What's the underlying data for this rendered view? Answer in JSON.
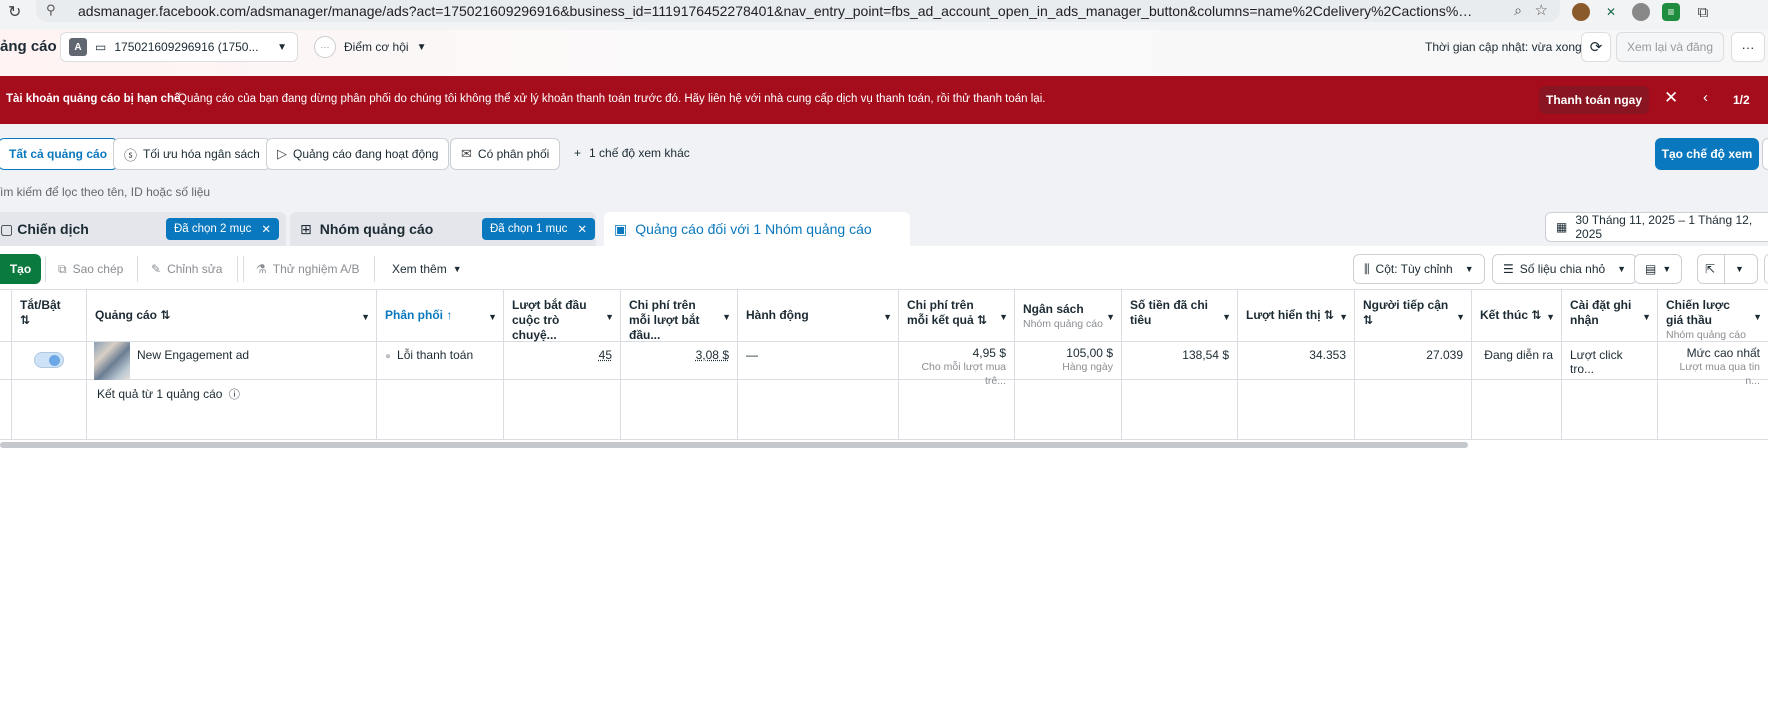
{
  "browser": {
    "url": "adsmanager.facebook.com/adsmanager/manage/ads?act=175021609296916&business_id=1119176452278401&nav_entry_point=fbs_ad_account_open_in_ads_manager_button&columns=name%2Cdelivery%2Cactions%3Aon..."
  },
  "header": {
    "title": "ảng cáo",
    "account_badge": "A",
    "account_label": "175021609296916 (1750...",
    "opportunity_label": "Điểm cơ hội",
    "updated_text": "Thời gian cập nhật: vừa xong",
    "review_label": "Xem lại và đăng",
    "more_label": "···"
  },
  "banner": {
    "title": "Tài khoản quảng cáo bị hạn chế",
    "text": "Quảng cáo của bạn đang dừng phân phối do chúng tôi không thể xử lý khoản thanh toán trước đó. Hãy liên hệ với nhà cung cấp dịch vụ thanh toán, rồi thử thanh toán lại.",
    "button": "Thanh toán ngay",
    "page": "1/2"
  },
  "views": {
    "tabs": [
      {
        "label": "Tất cả quảng cáo"
      },
      {
        "label": "Tối ưu hóa ngân sách"
      },
      {
        "label": "Quảng cáo đang hoạt động"
      },
      {
        "label": "Có phân phối"
      }
    ],
    "more": "1 chế độ xem khác",
    "create": "Tạo chế độ xem"
  },
  "search": {
    "placeholder": "ìm kiếm để lọc theo tên, ID hoặc số liệu"
  },
  "levels": {
    "campaign": "Chiến dịch",
    "campaign_chip": "Đã chọn 2 mục",
    "adset": "Nhóm quảng cáo",
    "adset_chip": "Đã chọn 1 mục",
    "ads": "Quảng cáo đối với 1 Nhóm quảng cáo",
    "date_range": "30 Tháng 11, 2025 – 1 Tháng 12, 2025"
  },
  "toolbar": {
    "create": "Tạo",
    "copy": "Sao chép",
    "edit": "Chỉnh sửa",
    "ab_test": "Thử nghiệm A/B",
    "more": "Xem thêm",
    "columns": "Cột: Tùy chỉnh",
    "breakdown": "Số liệu chia nhỏ"
  },
  "table": {
    "headers": {
      "toggle": "Tắt/Bật",
      "ad": "Quảng cáo",
      "delivery": "Phân phối",
      "conv_start": "Lượt bắt đầu cuộc trò chuyệ...",
      "cost_per_conv": "Chi phí trên mỗi lượt bắt đầu...",
      "action": "Hành động",
      "cost_per_result": "Chi phí trên mỗi kết quả",
      "budget": "Ngân sách",
      "budget_sub": "Nhóm quảng cáo",
      "spent": "Số tiền đã chi tiêu",
      "impressions": "Lượt hiển thị",
      "reach": "Người tiếp cận",
      "end": "Kết thúc",
      "attribution": "Cài đặt ghi nhận",
      "bid": "Chiến lược giá thầu",
      "bid_sub": "Nhóm quảng cáo"
    },
    "row": {
      "ad_name": "New Engagement ad",
      "delivery": "Lỗi thanh toán",
      "conv_start": "45",
      "cost_per_conv": "3,08 $",
      "action": "—",
      "cost_per_result": "4,95 $",
      "cost_per_result_sub": "Cho mỗi lượt mua trê...",
      "budget": "105,00 $",
      "budget_sub": "Hàng ngày",
      "spent": "138,54 $",
      "impressions": "34.353",
      "reach": "27.039",
      "end": "Đang diễn ra",
      "attribution": "Lượt click tro...",
      "bid": "Mức cao nhất",
      "bid_sub": "Lượt mua qua tin n..."
    },
    "summary": "Kết quả từ 1 quảng cáo"
  }
}
